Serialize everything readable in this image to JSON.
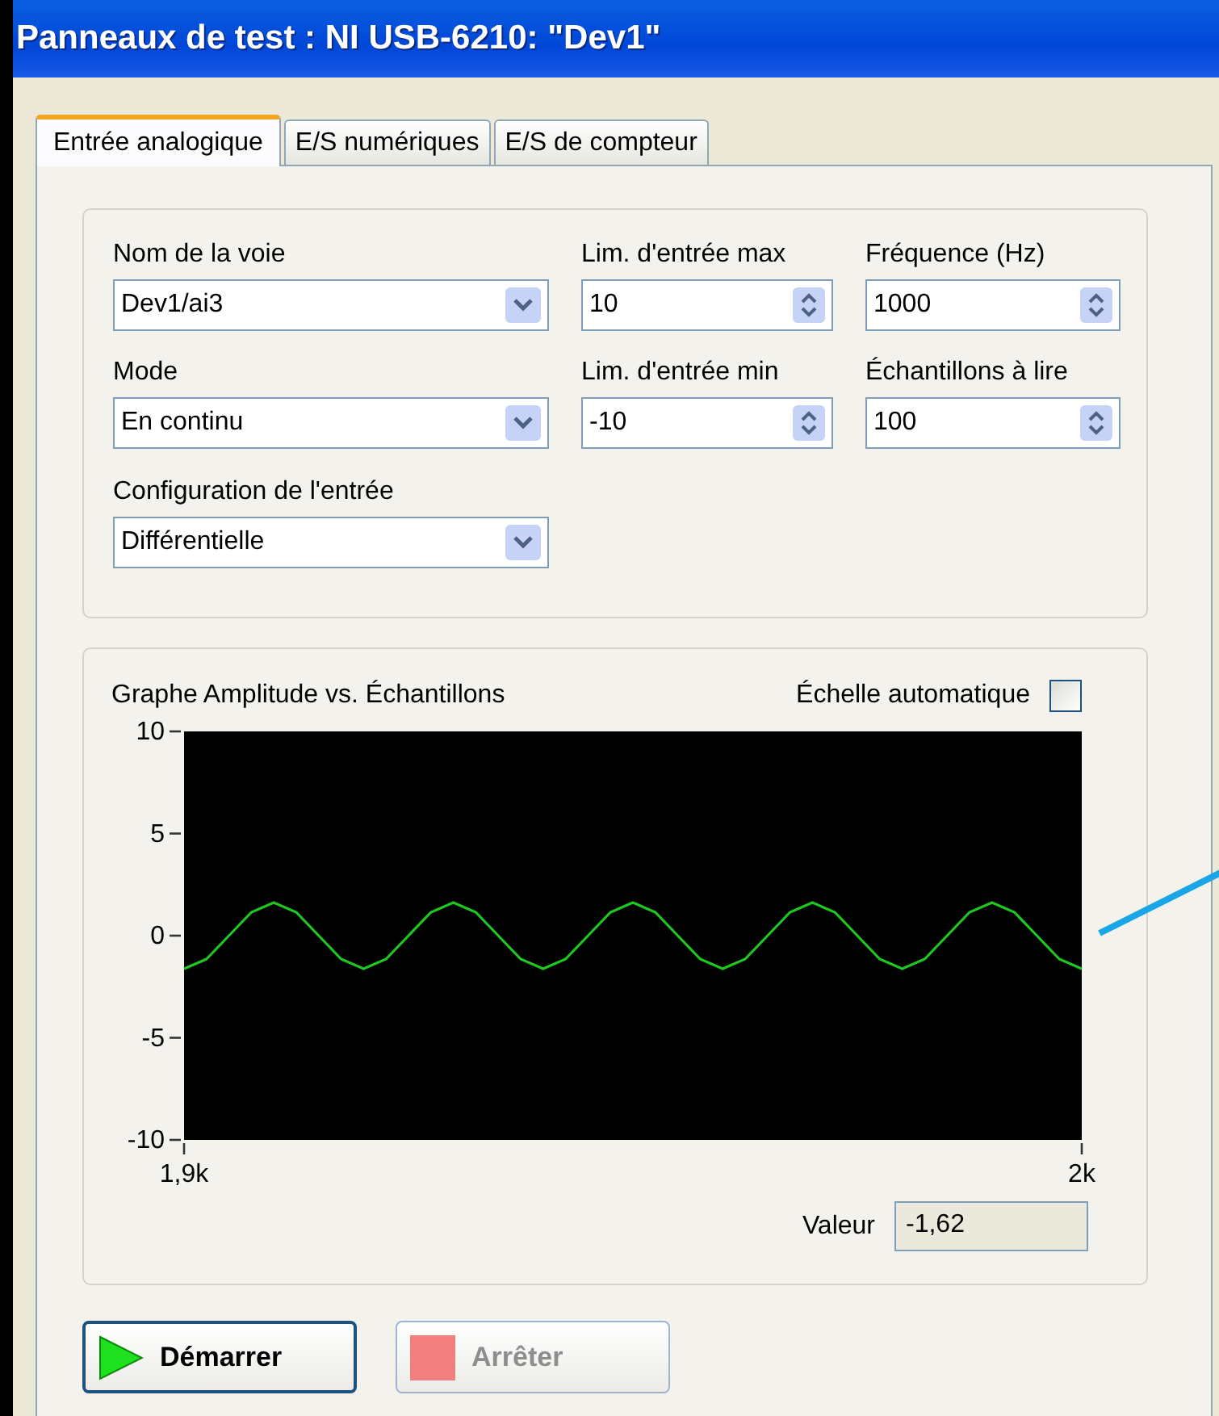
{
  "window": {
    "title": "Panneaux de test : NI USB-6210: \"Dev1\""
  },
  "tabs": [
    {
      "label": "Entrée analogique",
      "selected": true
    },
    {
      "label": "E/S numériques",
      "selected": false
    },
    {
      "label": "E/S de compteur",
      "selected": false
    }
  ],
  "settings": [
    {
      "label": "Nom de la voie",
      "value": "Dev1/ai3",
      "kind": "dropdown"
    },
    {
      "label": "Lim. d'entrée max",
      "value": "10",
      "kind": "numeric"
    },
    {
      "label": "Fréquence (Hz)",
      "value": "1000",
      "kind": "numeric"
    },
    {
      "label": "Mode",
      "value": "En continu",
      "kind": "dropdown"
    },
    {
      "label": "Lim. d'entrée min",
      "value": "-10",
      "kind": "numeric"
    },
    {
      "label": "Échantillons à lire",
      "value": "100",
      "kind": "numeric"
    },
    {
      "label": "Configuration de l'entrée",
      "value": "Différentielle",
      "kind": "dropdown"
    }
  ],
  "graph": {
    "title": "Graphe Amplitude vs. Échantillons",
    "autoscale": {
      "label": "Échelle automatique",
      "checked": false
    },
    "chart_data": {
      "type": "line",
      "xlim": [
        1900,
        2000
      ],
      "ylim": [
        -10,
        10
      ],
      "xticks": [
        {
          "value": 1900,
          "label": "1,9k"
        },
        {
          "value": 2000,
          "label": "2k"
        }
      ],
      "yticks": [
        10,
        5,
        0,
        -5,
        -10
      ],
      "x": [
        1900,
        1902.5,
        1905,
        1907.5,
        1910,
        1912.5,
        1915,
        1917.5,
        1920,
        1922.5,
        1925,
        1927.5,
        1930,
        1932.5,
        1935,
        1937.5,
        1940,
        1942.5,
        1945,
        1947.5,
        1950,
        1952.5,
        1955,
        1957.5,
        1960,
        1962.5,
        1965,
        1967.5,
        1970,
        1972.5,
        1975,
        1977.5,
        1980,
        1982.5,
        1985,
        1987.5,
        1990,
        1992.5,
        1995,
        1997.5,
        2000
      ],
      "series": [
        {
          "color": "#1ec81e",
          "values": [
            -1.62,
            -1.15,
            0,
            1.15,
            1.62,
            1.15,
            0,
            -1.15,
            -1.62,
            -1.15,
            0,
            1.15,
            1.62,
            1.15,
            0,
            -1.15,
            -1.62,
            -1.15,
            0,
            1.15,
            1.62,
            1.15,
            0,
            -1.15,
            -1.62,
            -1.15,
            0,
            1.15,
            1.62,
            1.15,
            0,
            -1.15,
            -1.62,
            -1.15,
            0,
            1.15,
            1.62,
            1.15,
            0,
            -1.15,
            -1.62
          ]
        }
      ]
    },
    "readout": {
      "label": "Valeur",
      "value": "-1,62"
    }
  },
  "buttons": [
    {
      "label": "Démarrer",
      "kind": "start",
      "disabled": false
    },
    {
      "label": "Arrêter",
      "kind": "stop",
      "disabled": true
    }
  ]
}
